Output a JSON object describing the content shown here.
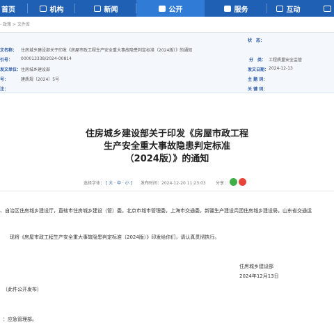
{
  "nav": {
    "items": [
      {
        "label": "首页",
        "active": false
      },
      {
        "label": "机构",
        "active": false
      },
      {
        "label": "新闻",
        "active": false
      },
      {
        "label": "公开",
        "active": true
      },
      {
        "label": "服务",
        "active": false
      },
      {
        "label": "互动",
        "active": false
      }
    ],
    "right_icon": "monitor-icon",
    "accent": "#1f5fb4"
  },
  "breadcrumb": "- 政策 > 文件库",
  "meta": {
    "title_label": "文名称：",
    "title_value": "住房城乡建设部关于印发《房屋市政工程生产安全重大事故隐患判定标准（2024版）》的通知",
    "index_label": "引号：",
    "index_value": "000013338/2024-00814",
    "category_label": "分　类：",
    "category_value": "工程质量安全监管",
    "issuer_label": "发文单位：",
    "issuer_value": "住房城乡建设部",
    "date_label": "发文日期：",
    "date_value": "2024-12-13",
    "docno_label": "号：",
    "docno_value": "建质规〔2024〕5号",
    "subject_label": "主 题 词：",
    "subject_value": "",
    "status_label": "状　态：",
    "status_value": "",
    "notes_label": "注：",
    "notes_value": "",
    "keyword_label": "关 键 词：",
    "keyword_value": ""
  },
  "title": {
    "line1": "住房城乡建设部关于印发《房屋市政工程",
    "line2": "生产安全重大事故隐患判定标准",
    "line3": "（2024版）》的通知"
  },
  "info": {
    "font_label": "选择字体：",
    "font_open": "[",
    "font_large": "大",
    "font_mid": "中",
    "font_small": "小",
    "font_close": "]",
    "dot1": "·",
    "dot2": "·",
    "published": "发布时间：2024-12-20 11:23:03",
    "share_label": "分享：",
    "share_icons": [
      "wechat-icon",
      "weibo-icon"
    ]
  },
  "body": {
    "recipients": "、自治区住房城乡建设厅，直辖市住房城乡建设（管）委，北京市城市管理委，上海市交通委，新疆生产建设兵团住房城乡建设局，山东省交通运",
    "paragraph": "现将《房屋市政工程生产安全重大事故隐患判定标准（2024版）》印发给你们，请认真贯彻执行。",
    "signer": "住房城乡建设部",
    "sign_date": "2024年12月13日",
    "publish_note": "（此件公开发布）",
    "cc": "：应急管理部。"
  }
}
